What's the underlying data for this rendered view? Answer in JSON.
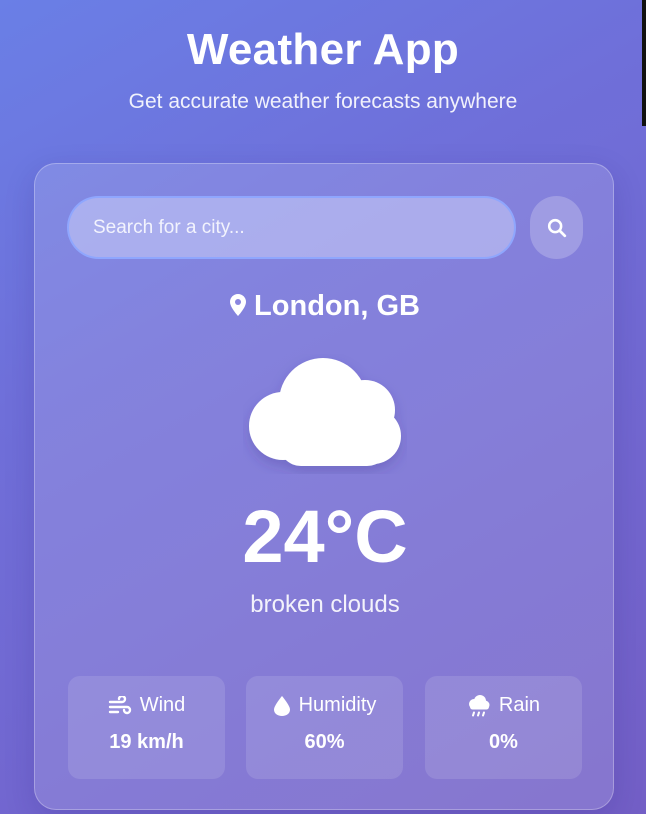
{
  "header": {
    "title": "Weather App",
    "subtitle": "Get accurate weather forecasts anywhere"
  },
  "search": {
    "placeholder": "Search for a city...",
    "value": "",
    "button_icon": "search-icon"
  },
  "current": {
    "location": "London, GB",
    "location_icon": "map-pin-icon",
    "condition_icon": "cloud-icon",
    "temperature": "24°C",
    "description": "broken clouds"
  },
  "stats": [
    {
      "label": "Wind",
      "value": "19 km/h",
      "icon": "wind-icon"
    },
    {
      "label": "Humidity",
      "value": "60%",
      "icon": "droplet-icon"
    },
    {
      "label": "Rain",
      "value": "0%",
      "icon": "cloud-rain-icon"
    }
  ],
  "colors": {
    "background_start": "#6a7fe6",
    "background_end": "#735fc6",
    "text": "#ffffff",
    "search_border": "#8ca5ff"
  }
}
